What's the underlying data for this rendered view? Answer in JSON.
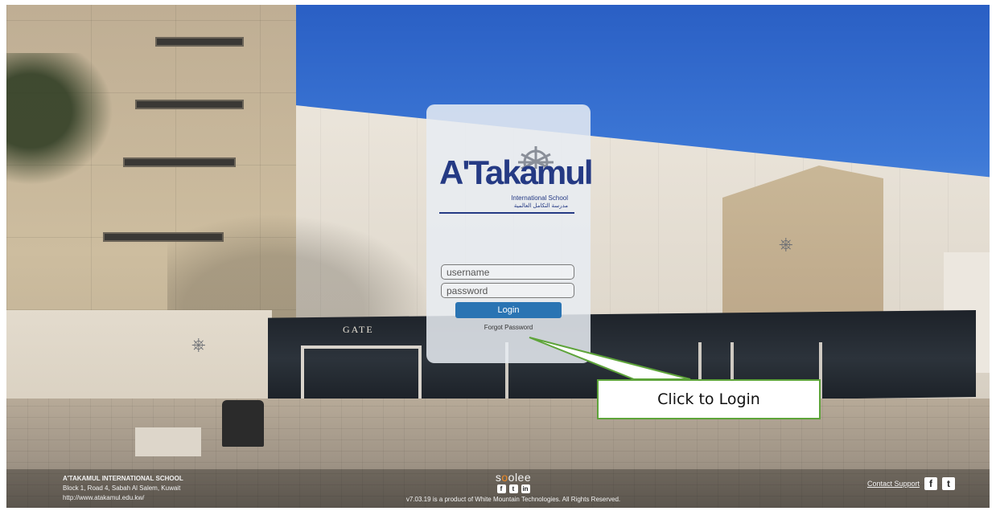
{
  "login": {
    "username_placeholder": "username",
    "password_placeholder": "password",
    "login_label": "Login",
    "forgot_label": "Forgot Password"
  },
  "logo": {
    "name": "A'Takamul",
    "subtitle": "International School",
    "arabic": "مدرسة التكامل العالمية"
  },
  "background": {
    "gate_text": "GATE"
  },
  "callout": {
    "text": "Click to Login"
  },
  "footer": {
    "school_name": "A'TAKAMUL INTERNATIONAL SCHOOL",
    "address": "Block 1, Road 4, Sabah Al Salem, Kuwait",
    "website": "http://www.atakamul.edu.kw/",
    "brand": "skoolee",
    "version": "v7.03.19",
    "copyright": "is a product of White Mountain Technologies. All Rights Reserved.",
    "contact_label": "Contact Support",
    "social_icons": [
      "facebook-icon",
      "twitter-icon",
      "linkedin-icon"
    ]
  },
  "colors": {
    "brand_blue": "#253a84",
    "login_button": "#2a74b3",
    "callout_border": "#5ea43a",
    "brand_orange": "#f08a24"
  }
}
